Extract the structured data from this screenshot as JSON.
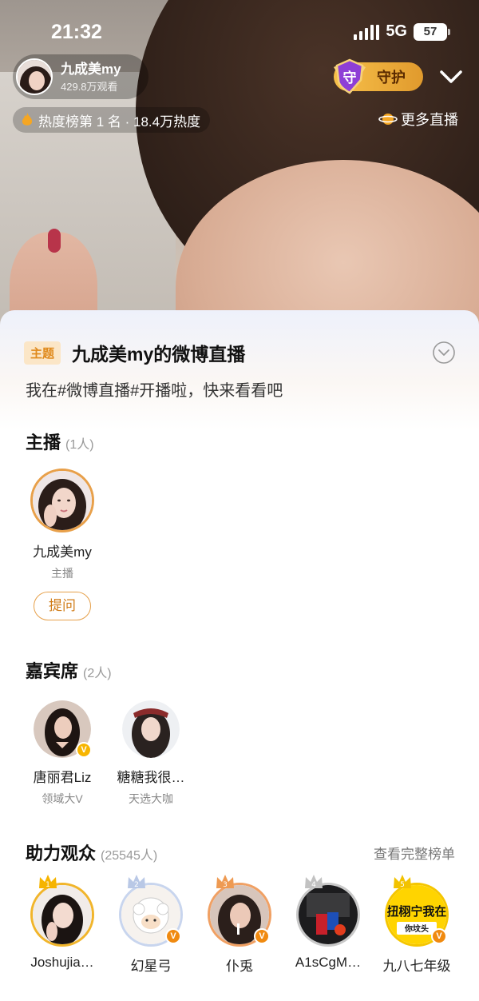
{
  "status_bar": {
    "time": "21:32",
    "network": "5G",
    "battery": "57"
  },
  "header": {
    "host_name": "九成美my",
    "viewers": "429.8万观看",
    "guard_label": "守护",
    "guard_badge_char": "守",
    "rank_text": "热度榜第 1 名 · 18.4万热度",
    "more_live": "更多直播"
  },
  "sheet": {
    "topic_tag": "主题",
    "topic_title": "九成美my的微博直播",
    "topic_desc": "我在#微博直播#开播啦，快来看看吧",
    "host_section": {
      "title": "主播",
      "count": "(1人)",
      "host": {
        "name": "九成美my",
        "role": "主播"
      },
      "ask_label": "提问"
    },
    "guest_section": {
      "title": "嘉宾席",
      "count": "(2人)",
      "guests": [
        {
          "name": "唐丽君Liz",
          "sub": "领域大V"
        },
        {
          "name": "糖糖我很…",
          "sub": "天选大咖"
        }
      ]
    },
    "audience_section": {
      "title": "助力观众",
      "count": "(25545人)",
      "more_label": "查看完整榜单",
      "members": [
        {
          "rank": "1",
          "name": "Joshujia…"
        },
        {
          "rank": "2",
          "name": "幻星弓"
        },
        {
          "rank": "3",
          "name": "仆兎"
        },
        {
          "rank": "4",
          "name": "A1sCgM…"
        },
        {
          "rank": "5",
          "name": "九八七年级",
          "avatar_text": "扭栩宁我在",
          "avatar_subtext": "你坟头"
        }
      ]
    }
  },
  "colors": {
    "accent": "#e08a1c",
    "gold": "#f1b52b",
    "guard": "#f0b040"
  }
}
